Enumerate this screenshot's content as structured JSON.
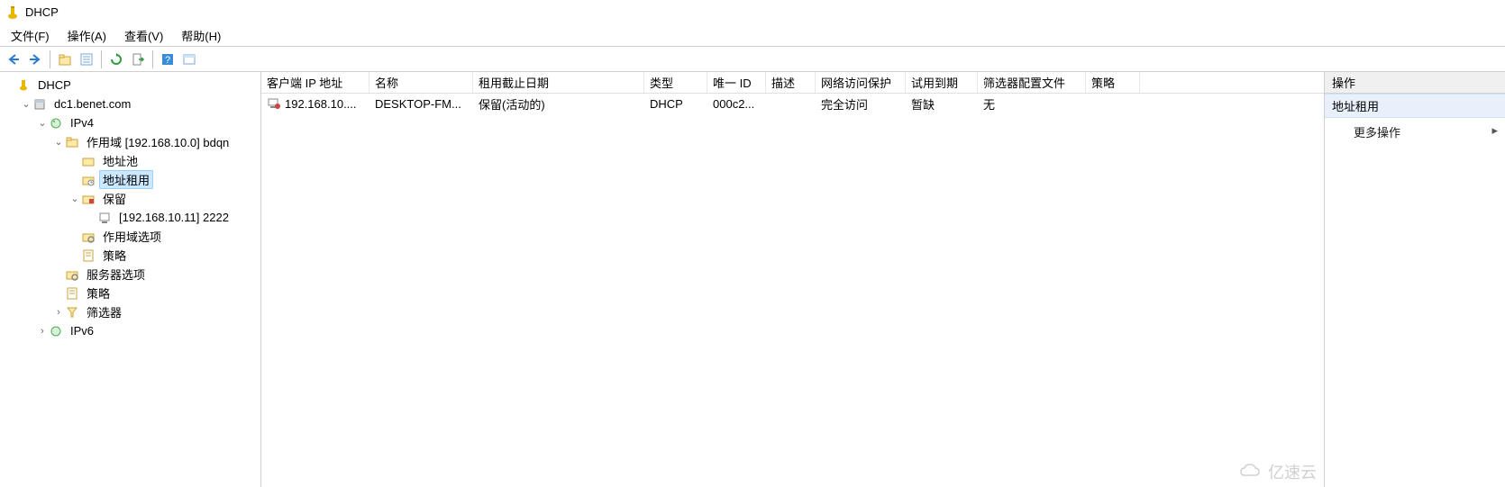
{
  "window": {
    "title": "DHCP"
  },
  "menu": {
    "file": "文件(F)",
    "action": "操作(A)",
    "view": "查看(V)",
    "help": "帮助(H)"
  },
  "toolbar_icons": {
    "back": "back-arrow",
    "forward": "forward-arrow",
    "up": "up-folder",
    "props": "properties",
    "refresh": "refresh",
    "export": "export-list",
    "help": "help",
    "panel": "toggle-pane"
  },
  "tree": {
    "root": "DHCP",
    "server": "dc1.benet.com",
    "ipv4": "IPv4",
    "scope": "作用域 [192.168.10.0] bdqn",
    "address_pool": "地址池",
    "leases": "地址租用",
    "reservations": "保留",
    "reservation_item": "[192.168.10.11] 2222",
    "scope_options": "作用域选项",
    "policies_scope": "策略",
    "server_options": "服务器选项",
    "policies_server": "策略",
    "filters": "筛选器",
    "ipv6": "IPv6"
  },
  "list": {
    "headers": {
      "client_ip": "客户端 IP 地址",
      "name": "名称",
      "lease_expiry": "租用截止日期",
      "type": "类型",
      "unique_id": "唯一 ID",
      "description": "描述",
      "nap": "网络访问保护",
      "probation": "试用到期",
      "filter_profile": "筛选器配置文件",
      "policy": "策略"
    },
    "rows": [
      {
        "client_ip": "192.168.10....",
        "name": "DESKTOP-FM...",
        "lease_expiry": "保留(活动的)",
        "type": "DHCP",
        "unique_id": "000c2...",
        "description": "",
        "nap": "完全访问",
        "probation": "暂缺",
        "filter_profile": "无",
        "policy": ""
      }
    ]
  },
  "actions": {
    "header": "操作",
    "section_title": "地址租用",
    "more": "更多操作"
  },
  "watermark": "亿速云"
}
